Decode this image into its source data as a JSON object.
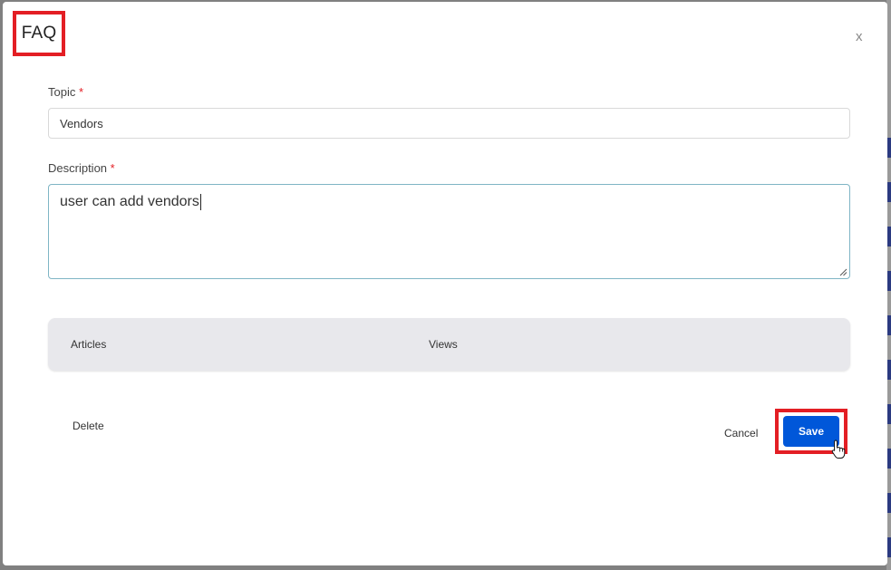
{
  "modal": {
    "title": "FAQ",
    "close_label": "x"
  },
  "form": {
    "topic": {
      "label": "Topic",
      "required_mark": "*",
      "value": "Vendors"
    },
    "description": {
      "label": "Description",
      "required_mark": "*",
      "value": "user can add vendors"
    }
  },
  "articles_table": {
    "columns": [
      "Articles",
      "Views"
    ]
  },
  "actions": {
    "delete_label": "Delete",
    "cancel_label": "Cancel",
    "save_label": "Save"
  },
  "colors": {
    "highlight": "#e31e24",
    "primary": "#0057d9",
    "required": "#e31e24"
  },
  "icons": {
    "cursor": "hand-pointer-icon",
    "resize": "resize-handle-icon"
  }
}
